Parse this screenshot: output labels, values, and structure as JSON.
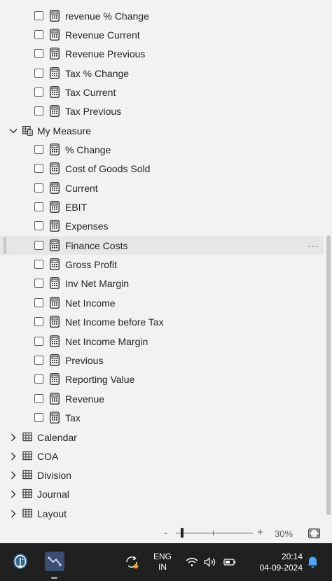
{
  "fields": {
    "prev_items": [
      {
        "label": "revenue % Change"
      },
      {
        "label": "Revenue Current"
      },
      {
        "label": "Revenue Previous"
      },
      {
        "label": "Tax % Change"
      },
      {
        "label": "Tax Current"
      },
      {
        "label": "Tax Previous"
      }
    ],
    "my_measure": {
      "label": "My Measure",
      "items": [
        {
          "label": "% Change"
        },
        {
          "label": "Cost of Goods Sold"
        },
        {
          "label": "Current"
        },
        {
          "label": "EBIT"
        },
        {
          "label": "Expenses"
        },
        {
          "label": "Finance Costs"
        },
        {
          "label": "Gross Profit"
        },
        {
          "label": "Inv Net Margin"
        },
        {
          "label": "Net Income"
        },
        {
          "label": "Net Income before Tax"
        },
        {
          "label": "Net Income Margin"
        },
        {
          "label": "Previous"
        },
        {
          "label": "Reporting Value"
        },
        {
          "label": "Revenue"
        },
        {
          "label": "Tax"
        }
      ]
    },
    "tables": [
      {
        "label": "Calendar"
      },
      {
        "label": "COA"
      },
      {
        "label": "Division"
      },
      {
        "label": "Journal"
      },
      {
        "label": "Layout"
      }
    ],
    "more_options": "···"
  },
  "zoom": {
    "minus": "-",
    "plus": "+",
    "percent": "30%",
    "level": 0.3
  },
  "taskbar": {
    "lang_line1": "ENG",
    "lang_line2": "IN",
    "time": "20:14",
    "date": "04-09-2024"
  }
}
